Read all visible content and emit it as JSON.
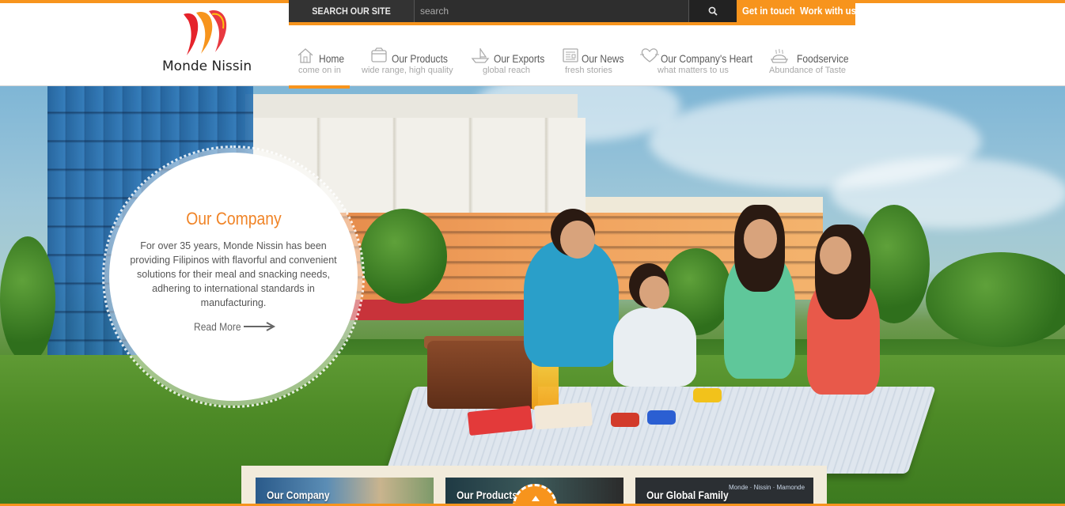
{
  "brand": {
    "name": "Monde Nissin",
    "accent": "#f7941d",
    "logo_colors": [
      "#e5232b",
      "#f7941d",
      "#ffc20e"
    ]
  },
  "topbar": {
    "search_label": "SEARCH OUR SITE",
    "search_placeholder": "search",
    "search_icon": "search-icon",
    "get_in_touch": "Get in touch",
    "work_with_us": "Work with us"
  },
  "nav": {
    "items": [
      {
        "title": "Home",
        "subtitle": "come on in",
        "icon": "house-icon",
        "active": true
      },
      {
        "title": "Our Products",
        "subtitle": "wide range, high quality",
        "icon": "product-box-icon"
      },
      {
        "title": "Our Exports",
        "subtitle": "global reach",
        "icon": "ship-icon"
      },
      {
        "title": "Our News",
        "subtitle": "fresh stories",
        "icon": "newspaper-icon"
      },
      {
        "title": "Our Company's Heart",
        "subtitle": "what matters to us",
        "icon": "heart-icon"
      },
      {
        "title": "Foodservice",
        "subtitle": "Abundance of Taste",
        "icon": "food-tray-icon"
      }
    ]
  },
  "hero": {
    "panel_title": "Our Company",
    "panel_text": "For over 35 years, Monde Nissin has been providing Filipinos with flavorful and convenient solutions for their meal and snacking needs, adhering to international standards in manufacturing.",
    "read_more": "Read More",
    "read_more_icon": "arrow-right-icon"
  },
  "cards": [
    {
      "label": "Our Company"
    },
    {
      "label": "Our Products"
    },
    {
      "label": "Our Global Family",
      "brand_logos": "Monde  · Nissin  ·  Mamonde"
    }
  ],
  "scroll_up_icon": "chevron-up-icon"
}
